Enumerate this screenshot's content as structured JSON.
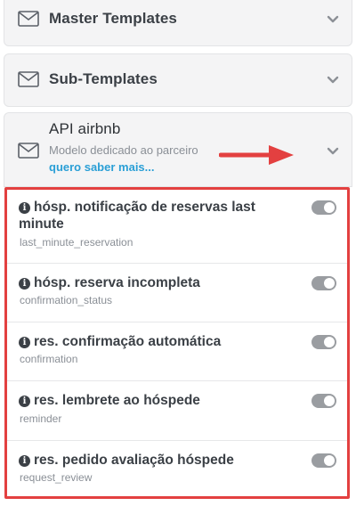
{
  "accordions": [
    {
      "title": "Master Templates"
    },
    {
      "title": "Sub-Templates"
    },
    {
      "title": "API airbnb",
      "subtitle": "Modelo dedicado ao parceiro",
      "link": "quero saber mais..."
    }
  ],
  "templates": [
    {
      "label": "hósp. notificação de reservas last minute",
      "code": "last_minute_reservation",
      "enabled": true
    },
    {
      "label": "hósp. reserva incompleta",
      "code": "confirmation_status",
      "enabled": true
    },
    {
      "label": "res. confirmação automática",
      "code": "confirmation",
      "enabled": true
    },
    {
      "label": "res. lembrete ao hóspede",
      "code": "reminder",
      "enabled": true
    },
    {
      "label": "res. pedido avaliação hóspede",
      "code": "request_review",
      "enabled": true
    }
  ],
  "colors": {
    "highlight": "#e34040",
    "link": "#2a9fd6",
    "toggle": "#9a9da1"
  },
  "icons": {
    "section": "envelope-icon",
    "expand": "chevron-down-icon",
    "info": "info-icon",
    "callout": "arrow-right-icon"
  }
}
